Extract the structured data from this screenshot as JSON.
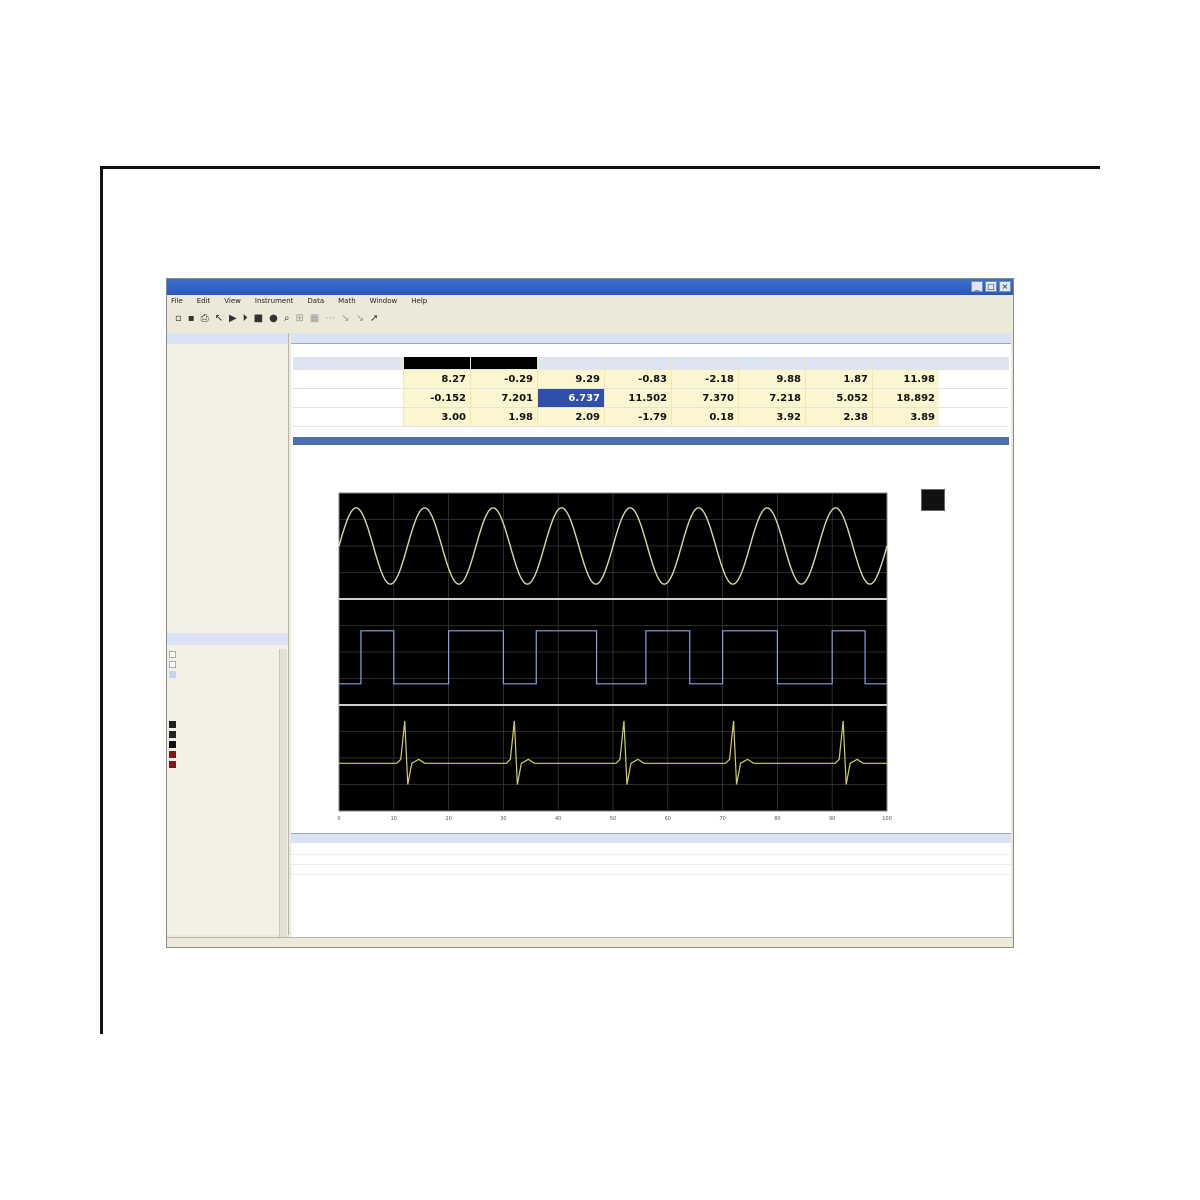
{
  "window": {
    "title": "",
    "controls": [
      "_",
      "□",
      "×"
    ]
  },
  "menu": [
    "File",
    "Edit",
    "View",
    "Instrument",
    "Data",
    "Math",
    "Window",
    "Help"
  ],
  "toolbar_icons": [
    "new-icon",
    "save-icon",
    "print-icon",
    "cursor-icon",
    "play-icon",
    "stop-icon",
    "record-icon",
    "zoom-icon",
    "measure-icon",
    "marker-icon"
  ],
  "left_panel": {
    "header": "",
    "nav_items": [
      "",
      "",
      "",
      "",
      "",
      "",
      "",
      ""
    ],
    "nav_items_2": [
      "",
      "",
      "",
      ""
    ],
    "options_header": ""
  },
  "readings": {
    "columns": [
      "",
      "",
      "",
      "",
      "",
      "",
      "",
      ""
    ],
    "rows": [
      {
        "name": "",
        "values": [
          "8.27",
          "-0.29",
          "9.29",
          "-0.83",
          "-2.18",
          "9.88",
          "1.87",
          "11.98"
        ]
      },
      {
        "name": "",
        "values": [
          "-0.152",
          "7.201",
          "6.737",
          "11.502",
          "7.370",
          "7.218",
          "5.052",
          "18.892"
        ]
      },
      {
        "name": "",
        "values": [
          "3.00",
          "1.98",
          "2.09",
          "-1.79",
          "0.18",
          "3.92",
          "2.38",
          "3.89"
        ]
      }
    ]
  },
  "chart_data": {
    "type": "line",
    "title": "",
    "xlabel": "",
    "xlim": [
      0,
      100
    ],
    "x_ticks": [
      "0",
      "10",
      "20",
      "30",
      "40",
      "50",
      "60",
      "70",
      "80",
      "90",
      "100"
    ],
    "series": [
      {
        "values_shape": "sine",
        "cycles": 8,
        "color": "#d8d8a0"
      },
      {
        "values_shape": "square-pulse",
        "color": "#8aa0e0"
      },
      {
        "values_shape": "ecg-spikes",
        "spikes": 5,
        "color": "#d0d060"
      }
    ],
    "grid": true,
    "background": "#000000"
  },
  "colors": {
    "title_bar": "#2a57b8",
    "reading_bg": "#fbf6cf",
    "selected": "#2f4fa8",
    "plot_bg": "#000000"
  }
}
